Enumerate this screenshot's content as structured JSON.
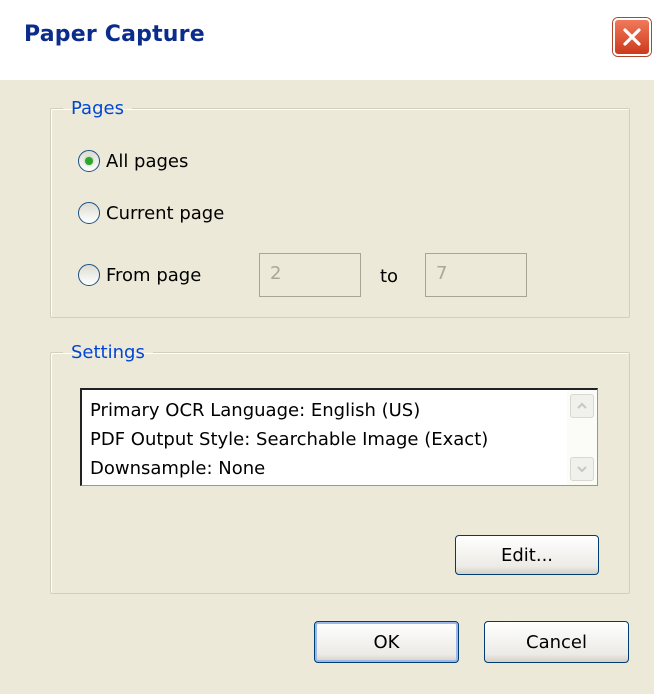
{
  "window": {
    "title": "Paper Capture",
    "close_icon": "close-x-icon",
    "close_color": "#d84c2c"
  },
  "pages_group": {
    "legend": "Pages",
    "options": [
      {
        "label": "All pages",
        "checked": true
      },
      {
        "label": "Current page",
        "checked": false
      },
      {
        "label": "From page",
        "checked": false
      }
    ],
    "from_value": "2",
    "to_label": "to",
    "to_value": "7"
  },
  "settings_group": {
    "legend": "Settings",
    "lines": [
      "Primary OCR Language: English (US)",
      "PDF Output Style: Searchable Image (Exact)",
      "Downsample: None"
    ],
    "edit_label": "Edit..."
  },
  "buttons": {
    "ok_label": "OK",
    "cancel_label": "Cancel"
  },
  "colors": {
    "dialog_bg": "#ece9d8",
    "legend_text": "#0046d5",
    "title_text": "#0b2c8a",
    "radio_dot": "#2fa52f"
  }
}
